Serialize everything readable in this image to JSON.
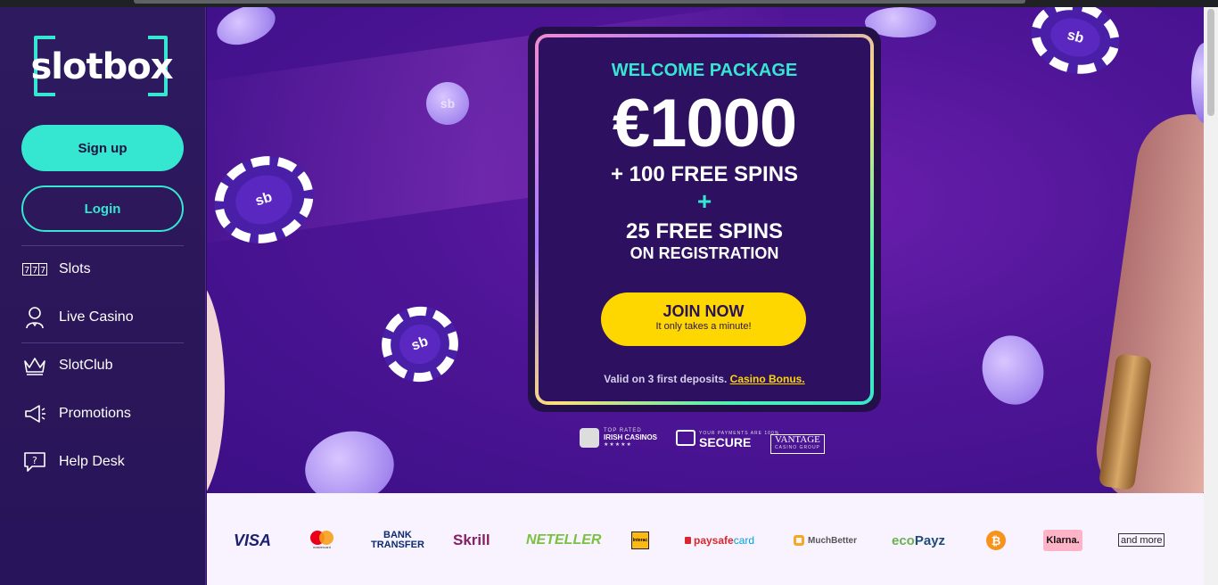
{
  "brand": {
    "name": "slotbox"
  },
  "auth": {
    "signup_label": "Sign up",
    "login_label": "Login"
  },
  "nav": {
    "items": [
      {
        "label": "Slots",
        "icon": "slot-machine-icon"
      },
      {
        "label": "Live Casino",
        "icon": "dealer-icon"
      },
      {
        "label": "SlotClub",
        "icon": "crown-icon"
      },
      {
        "label": "Promotions",
        "icon": "megaphone-icon"
      },
      {
        "label": "Help Desk",
        "icon": "help-chat-icon"
      }
    ]
  },
  "promo": {
    "eyebrow": "WELCOME PACKAGE",
    "amount": "€1000",
    "line1": "+ 100 FREE SPINS",
    "plus": "+",
    "line2": "25 FREE SPINS",
    "line3": "ON REGISTRATION",
    "cta_label": "JOIN NOW",
    "cta_sub": "It only takes a minute!",
    "valid_text": "Valid on 3 first deposits.",
    "valid_link": "Casino Bonus."
  },
  "trust": {
    "irish_top": "TOP RATED",
    "irish_main": "IRISH CASINOS",
    "irish_stars": "★★★★★",
    "secure_small": "YOUR PAYMENTS ARE 100%",
    "secure_main": "SECURE",
    "vantage_main": "VANTAGE",
    "vantage_sub": "CASINO GROUP"
  },
  "chips": {
    "label": "sb"
  },
  "payments": {
    "visa": "VISA",
    "mastercard_text": "mastercard",
    "bank_1": "BANK",
    "bank_2": "TRANSFER",
    "skrill": "Skrill",
    "neteller": "NETELLER",
    "interac": "Interac",
    "paysafe_1": "paysafe",
    "paysafe_2": "card",
    "muchbetter": "MuchBetter",
    "ecopayz_1": "eco",
    "ecopayz_2": "Payz",
    "bitcoin": "₿",
    "klarna": "Klarna.",
    "more": "and more"
  },
  "colors": {
    "accent": "#35e7d0",
    "cta": "#ffd700",
    "sidebar": "#2e1a5f",
    "hero": "#4f1597"
  }
}
